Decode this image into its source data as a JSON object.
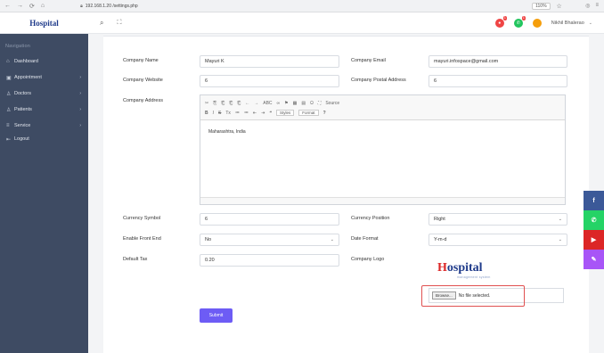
{
  "browser": {
    "nav_icons": [
      "←",
      "→",
      "⟳",
      "⌂"
    ],
    "url": "192.168.1.20 /settings.php",
    "zoom": "110%",
    "star": "☆"
  },
  "sidebar": {
    "logo": "Hospital",
    "nav_heading": "Navigation",
    "items": [
      {
        "icon": "⌂",
        "label": "Dashboard",
        "chevron": ""
      },
      {
        "icon": "▣",
        "label": "Appointment",
        "chevron": "›"
      },
      {
        "icon": "♙",
        "label": "Doctors",
        "chevron": "›"
      },
      {
        "icon": "♙",
        "label": "Patients",
        "chevron": "›"
      },
      {
        "icon": "≡",
        "label": "Service",
        "chevron": "›"
      },
      {
        "icon": "⇤",
        "label": "Logout",
        "chevron": ""
      }
    ]
  },
  "header": {
    "search_icon": "⌕",
    "expand_icon": "⛶",
    "notif_count": "1",
    "whatsapp_count": "1",
    "user_name": "Nikhil Bhalerao",
    "chevron": "⌄"
  },
  "form": {
    "company_name_label": "Company Name",
    "company_name_value": "Mayuri K",
    "company_email_label": "Company Email",
    "company_email_value": "mayuri.infospace@gmail.com",
    "company_website_label": "Company Website",
    "company_website_value": "6",
    "company_postal_label": "Company Postal Address",
    "company_postal_value": "6",
    "company_address_label": "Company Address",
    "company_address_value": "Maharashtra, India",
    "currency_symbol_label": "Currency Symbol",
    "currency_symbol_value": "6",
    "currency_position_label": "Currency Position",
    "currency_position_value": "Right",
    "enable_front_label": "Enable Front End",
    "enable_front_value": "No",
    "date_format_label": "Date Format",
    "date_format_value": "Y-m-d",
    "default_tax_label": "Default Tax",
    "default_tax_value": "0.20",
    "company_logo_label": "Company Logo",
    "browse_label": "Browse...",
    "no_file_label": "No file selected.",
    "submit_label": "Submit"
  },
  "editor": {
    "row1": [
      "✂",
      "⎘",
      "⎗",
      "⎗",
      "⎗",
      "←",
      "→",
      "ABC",
      "∞",
      "⚑",
      "▦",
      "▤",
      "Ω",
      "⛶",
      "Source"
    ],
    "row2": [
      "B",
      "I",
      "S",
      "Tx",
      "≔",
      "≔",
      "⇤",
      "⇥",
      "❝"
    ],
    "styles_label": "Styles",
    "format_label": "Format",
    "help_label": "?"
  },
  "preview_logo": {
    "h": "H",
    "rest": "ospital",
    "sub": "management system"
  },
  "social": [
    {
      "icon": "f",
      "color": "#3b5998"
    },
    {
      "icon": "✆",
      "color": "#25d366"
    },
    {
      "icon": "▶",
      "color": "#dc2626"
    },
    {
      "icon": "✎",
      "color": "#a855f7"
    }
  ]
}
